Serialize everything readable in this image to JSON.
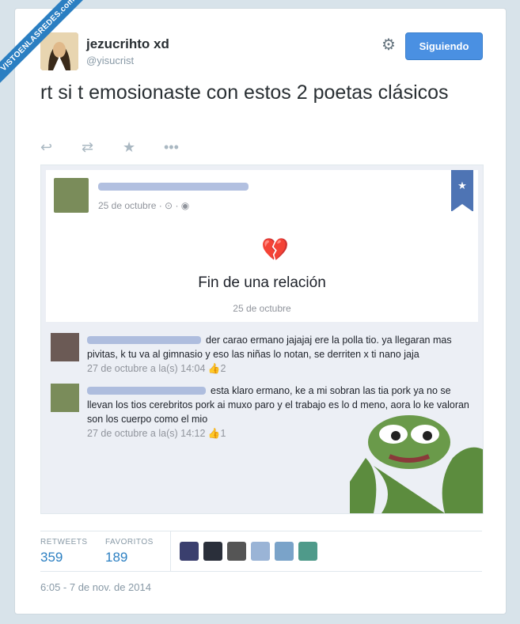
{
  "watermark": "VISTOENLASREDES.com",
  "user": {
    "name": "jezucrihto xd",
    "handle": "@yisucrist"
  },
  "follow_label": "Siguiendo",
  "tweet_text": "rt si t emosionaste con estos 2 poetas clásicos",
  "fb": {
    "post_date": "25 de octubre · ⊙ · ◉",
    "event_title": "Fin de una relación",
    "event_date": "25 de octubre",
    "comments": [
      {
        "text": "der carao ermano jajajaj ere la polla tio. ya llegaran mas pivitas, k tu va al gimnasio y eso las niñas lo notan, se derriten x ti nano jaja",
        "meta": "27 de octubre a la(s) 14:04",
        "likes": "2"
      },
      {
        "text": "esta klaro ermano, ke a mi sobran las tia pork ya no se llevan los tios cerebritos pork ai muxo paro y el trabajo es lo d meno, aora lo ke valoran son los cuerpo como el mio",
        "meta": "27 de octubre a la(s) 14:12",
        "likes": "1"
      }
    ]
  },
  "stats": {
    "retweets_label": "RETWEETS",
    "retweets": "359",
    "favorites_label": "FAVORITOS",
    "favorites": "189"
  },
  "timestamp": "6:05 - 7 de nov. de 2014"
}
